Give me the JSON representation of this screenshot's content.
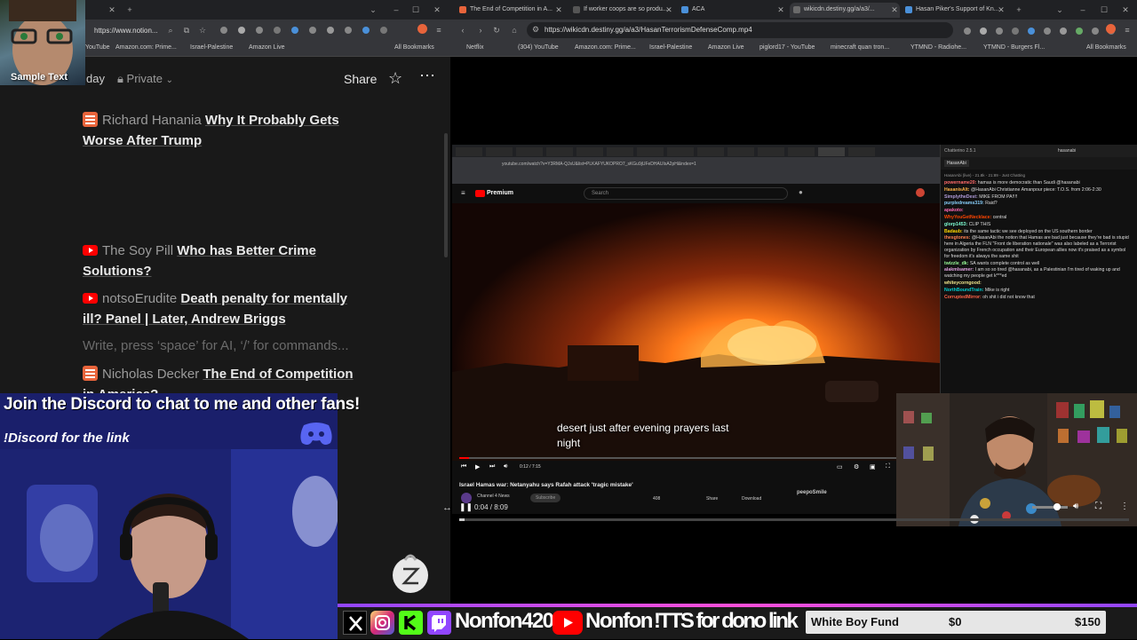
{
  "webcam_overlay": {
    "label": "Sample Text"
  },
  "left_browser": {
    "url": "https://www.notion...",
    "bookmarks": [
      "YouTube",
      "Amazon.com: Prime...",
      "Israel-Palestine",
      "Amazon Live"
    ],
    "all_bookmarks": "All Bookmarks"
  },
  "notion": {
    "breadcrumb_partial": "day",
    "privacy": "Private",
    "share_label": "Share",
    "items": [
      {
        "source": "Richard Hanania",
        "title_line1": "Why It Probably Gets",
        "title_line2": "Worse After Trump",
        "icon": "rss-icon"
      },
      {
        "source": "The Soy Pill",
        "title_line1": "Who has Better Crime",
        "title_line2": "Solutions?",
        "icon": "youtube-icon"
      },
      {
        "source": "notsoErudite",
        "title_line1": "Death penalty for mentally",
        "title_line2": "ill? Panel | Later, Andrew Briggs",
        "icon": "youtube-icon"
      },
      {
        "source": "Nicholas Decker",
        "title_line1": "The End of Competition",
        "title_line2": "in America?",
        "icon": "rss-icon"
      }
    ],
    "placeholder": "Write, press ‘space’ for AI, ‘/’ for commands..."
  },
  "discord_banner": {
    "line1": "Join the Discord to chat to me and other fans!",
    "line2": "!Discord for the link"
  },
  "right_browser": {
    "tabs": [
      {
        "label": "The End of Competition in A...",
        "color": "#e8643b"
      },
      {
        "label": "If worker coops are so produ...",
        "color": "#555555"
      },
      {
        "label": "ACA",
        "color": "#4a90d9"
      },
      {
        "label": "wikicdn.destiny.gg/a/a3/...",
        "color": "#6a6a6a"
      },
      {
        "label": "Hasan Piker's Support of Kn...",
        "color": "#4a90d9"
      }
    ],
    "url": "https://wikicdn.destiny.gg/a/a3/HasanTerrorismDefenseComp.mp4",
    "bookmarks": [
      "Netflix",
      "(304) YouTube",
      "Amazon.com: Prime...",
      "Israel-Palestine",
      "Amazon Live",
      "piglord17 - YouTube",
      "minecraft quan tron...",
      "YTMND - Radiohe...",
      "YTMND - Burgers Fl..."
    ],
    "all_bookmarks": "All Bookmarks"
  },
  "inner_video": {
    "yt_url": "youtube.com/watch?v=Y3RMA-QJsU&list=PLKAFYUKOPRO7_sKGu9jUFeDHAUIsA2pH&index=1",
    "yt_search_placeholder": "Search",
    "yt_logo": "Premium",
    "subtitle_line1": "desert just after evening prayers last",
    "subtitle_line2": "night",
    "inner_time": "0:12 / 7:15",
    "video_title": "Israel Hamas war: Netanyahu says Rafah attack 'tragic mistake'",
    "channel": "Channel 4 News",
    "subscribe": "Subscribe",
    "likes": "408",
    "share": "Share",
    "download": "Download",
    "commenter": "peepoSmile",
    "outer_time": "0:04 / 8:09",
    "outer_progress": 0.008
  },
  "chat": {
    "title": "Chatterino 2.5.1",
    "channel": "hasanabi",
    "tab": "HasanAbi",
    "status": "HasanAbi (live) - 21.8k - 21:89 - Just Chatting",
    "messages": [
      {
        "user": "powername20",
        "text": "hamas is more democratic than Saudi @hasanabi",
        "color": "#ff6b6b"
      },
      {
        "user": "HasanisAlt",
        "text": "@HasanAbi Christianne Amanpour piece: T.O.S. from 2:06-2:30",
        "color": "#ffb347"
      },
      {
        "user": "SimplytheDest",
        "text": "MIKE FROM PA!!!!",
        "color": "#b19cd9"
      },
      {
        "user": "purpledreams319",
        "text": "Raid?",
        "color": "#87cefa"
      },
      {
        "user": "apakoto",
        "text": "",
        "color": "#ff69b4"
      },
      {
        "user": "WhyYouGetNecklace",
        "text": "central",
        "color": "#ff4500"
      },
      {
        "user": "glorp1453",
        "text": "CLIP THIS",
        "color": "#7fffd4"
      },
      {
        "user": "Badaub",
        "text": "its the same tactic we see deployed on the US southern border",
        "color": "#ffd700"
      },
      {
        "user": "thesgtones",
        "text": "@HasanAbi the notion that Hamas are bad just because they're bad is stupid here in Algeria the FLN \"Front de liberation nationale\" was also labeled as a Terrorist organization by French occupation and their European allies now it's praised as a symbol for freedom it's always the same shit",
        "color": "#ff7f50"
      },
      {
        "user": "twizzle_dk",
        "text": "SA wants complete control as well",
        "color": "#98fb98"
      },
      {
        "user": "alakmlsamer",
        "text": "I am so so tired @hasanabi, as a Palestinian I'm tired of waking up and watching my people get k***ed",
        "color": "#dda0dd"
      },
      {
        "user": "whiteycorngood",
        "text": "",
        "color": "#f0e68c"
      },
      {
        "user": "NorthBoundTrain",
        "text": "Mike is right",
        "color": "#00ced1"
      },
      {
        "user": "CorruptedMirror",
        "text": "oh shit i did not know that",
        "color": "#ff6347"
      }
    ]
  },
  "bottom_bar": {
    "handle1": "Nonfon420",
    "handle2": "Nonfon",
    "tts": "!TTS for dono link",
    "fund_label": "White Boy Fund",
    "fund_current": "$0",
    "fund_goal": "$150",
    "fund_progress": 0
  }
}
